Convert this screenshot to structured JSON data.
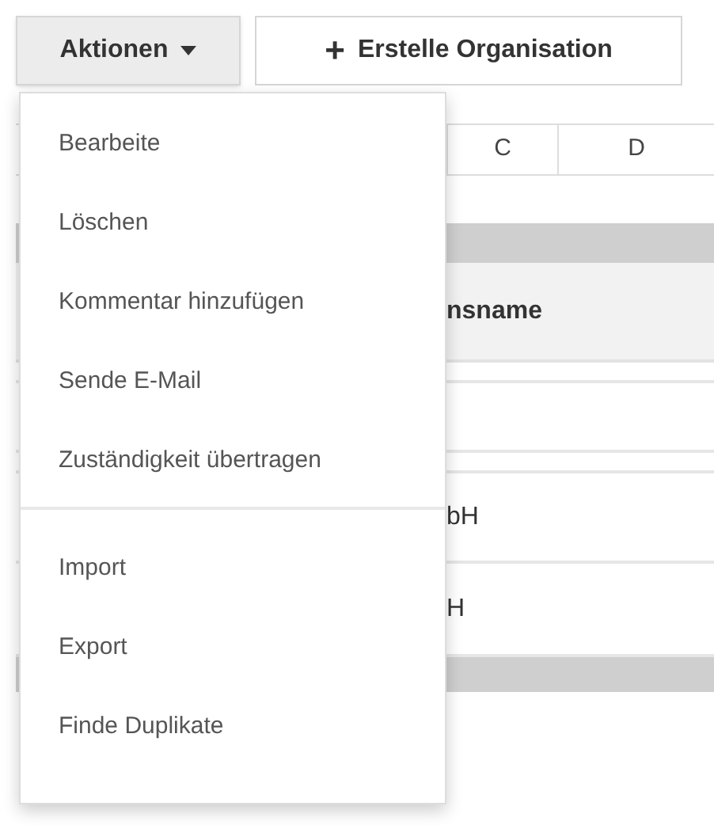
{
  "toolbar": {
    "actions_button": {
      "label": "Aktionen"
    },
    "create_button": {
      "icon_label": "+",
      "label": "Erstelle Organisation"
    }
  },
  "table": {
    "letter_columns": [
      "C",
      "D"
    ],
    "header": "nsname",
    "rows": [
      "",
      "",
      "",
      "bH",
      "H"
    ]
  },
  "menu": {
    "groups": [
      [
        "Bearbeite",
        "Löschen",
        "Kommentar hinzufügen",
        "Sende E-Mail",
        "Zuständigkeit übertragen"
      ],
      [
        "Import",
        "Export",
        "Finde Duplikate"
      ]
    ]
  }
}
